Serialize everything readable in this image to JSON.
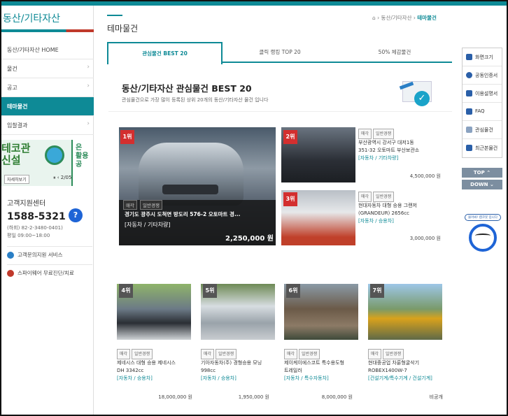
{
  "sidebar": {
    "title": "동산/기타자산",
    "items": [
      {
        "label": "동산/기타자산 HOME",
        "chev": ""
      },
      {
        "label": "물건",
        "chev": "›"
      },
      {
        "label": "공고",
        "chev": "›"
      },
      {
        "label": "테마물건",
        "chev": ""
      },
      {
        "label": "입찰결과",
        "chev": "›"
      }
    ],
    "banner": {
      "line1": "테코관",
      "line2": "신설",
      "right1": "은",
      "right2": "활용",
      "right3": "공",
      "btn": "자세히보기",
      "ctrl": "⏸ ‹ 2/05"
    },
    "cs": {
      "label": "고객지원센터",
      "phone": "1588-5321",
      "sub1": "(하회) 82-2-3480-0401)",
      "sub2": "평일 09:00~18:00",
      "q": "?"
    },
    "links": [
      {
        "label": "고객문의지원 서비스",
        "color": "#2a7fc6"
      },
      {
        "label": "스파이웨어 무료진단/치료",
        "color": "#c0392b"
      }
    ]
  },
  "header": {
    "title": "테마물건",
    "breadcrumb": {
      "home": "⌂",
      "sep": "›",
      "mid": "동산/기타자산",
      "current": "테마물건"
    }
  },
  "tabs": [
    {
      "label": "관심물건 BEST 20"
    },
    {
      "label": "클릭 랭킹 TOP 20"
    },
    {
      "label": "50% 체감물건"
    }
  ],
  "hero": {
    "heading": "동산/기타자산 관심물건 BEST 20",
    "sub": "관심물건으로 가장 많이 등록된 상위 20개의 동산/기타자산 물건 입니다",
    "check": "✓"
  },
  "featured": {
    "rank": "1위",
    "tag1": "매각",
    "tag2": "일반경쟁",
    "title": "경기도 광주시 도척면 방도리 576-2 오토마트 경...",
    "category": "[자동차 / 기타차량]",
    "price": "2,250,000 원"
  },
  "side_items": [
    {
      "rank": "2위",
      "tag1": "매각",
      "tag2": "일반경쟁",
      "title1": "부산광역시 강서구 대저1동",
      "title2": "351-32 오토마트 부산보관소",
      "category": "[자동차 / 기타차량]",
      "price": "4,500,000 원"
    },
    {
      "rank": "3위",
      "tag1": "매각",
      "tag2": "일반경쟁",
      "title1": "현대자동차 대형 승용 그랜저",
      "title2": "(GRANDEUR) 2656cc",
      "category": "[자동차 / 승용차]",
      "price": "3,000,000 원"
    }
  ],
  "grid_items": [
    {
      "rank": "4위",
      "tag1": "매각",
      "tag2": "일반경쟁",
      "title1": "제네시스 대형 승용 제네시스",
      "title2": "DH 3342cc",
      "category": "[자동차 / 승용차]",
      "price": "18,000,000 원"
    },
    {
      "rank": "5위",
      "tag1": "매각",
      "tag2": "일반경쟁",
      "title1": "기아자동차(주) 경형승용 모닝",
      "title2": "998cc",
      "category": "[자동차 / 승용차]",
      "price": "1,950,000 원"
    },
    {
      "rank": "6위",
      "tag1": "매각",
      "tag2": "일반경쟁",
      "title1": "제이케이에스코트 특수용도형",
      "title2": "트레일러",
      "category": "[자동차 / 특수자동차]",
      "price": "8,000,000 원"
    },
    {
      "rank": "7위",
      "tag1": "매각",
      "tag2": "일반경쟁",
      "title1": "현대중공업 차륜형굴삭기",
      "title2": "ROBEX1400W-7",
      "category": "[건설기계/특수기계 / 건설기계]",
      "price": "비공개"
    }
  ],
  "quick_menu": [
    {
      "label": "화면크기",
      "icon": "screen-size-icon"
    },
    {
      "label": "공동인증서",
      "icon": "certificate-icon"
    },
    {
      "label": "이용설명서",
      "icon": "manual-icon"
    },
    {
      "label": "FAQ",
      "icon": "faq-icon"
    },
    {
      "label": "관심물건",
      "icon": "heart-icon"
    },
    {
      "label": "최근본물건",
      "icon": "recent-icon"
    }
  ],
  "nav": {
    "top": "TOP ⌃",
    "down": "DOWN ⌄"
  },
  "bot": {
    "bubble": "물어봐! 캠코봇 입니다"
  },
  "colors": {
    "accent": "#0e8a96",
    "rank": "#d32f2f"
  }
}
